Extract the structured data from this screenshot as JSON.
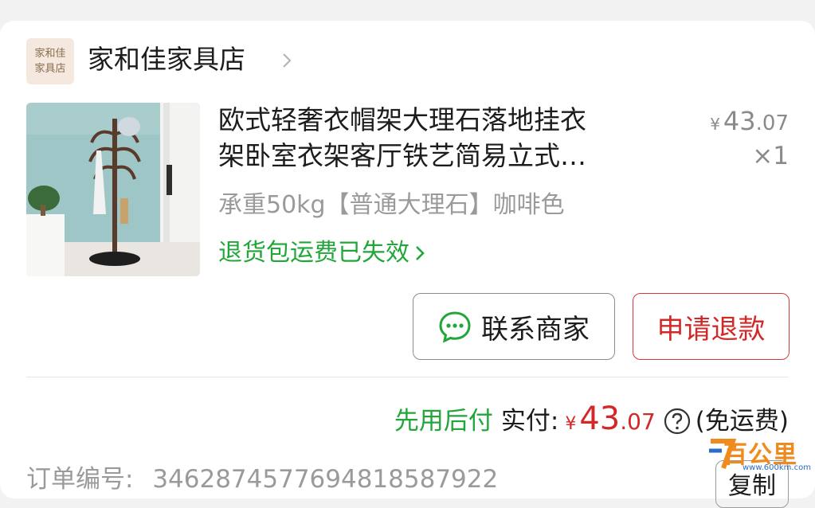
{
  "store": {
    "logo_line1": "家和佳",
    "logo_line2": "家具店",
    "name": "家和佳家具店"
  },
  "item": {
    "title_line1": "欧式轻奢衣帽架大理石落地挂衣",
    "title_line2": "架卧室衣架客厅铁艺简易立式…",
    "price_currency": "¥",
    "price_int": "43",
    "price_dec": ".07",
    "quantity": "×1",
    "spec": "承重50kg【普通大理石】咖啡色",
    "return_note": "退货包运费已失效"
  },
  "actions": {
    "contact_seller": "联系商家",
    "request_refund": "申请退款"
  },
  "payment": {
    "pay_later": "先用后付",
    "paid_label": "实付:",
    "currency": "¥",
    "amount_int": "43",
    "amount_dec": ".07",
    "shipping": "(免运费)"
  },
  "order": {
    "number_label": "订单编号:",
    "number_value": "3462874577694818587922",
    "copy_button": "复制"
  },
  "watermark": {
    "brand": "百公里",
    "url": "www.600km.com"
  },
  "colors": {
    "green": "#21a639",
    "red": "#d22828",
    "gray_text": "#9a9a9a"
  },
  "icons": [
    "chevron-right-icon",
    "chat-bubble-icon",
    "help-circle-icon"
  ]
}
